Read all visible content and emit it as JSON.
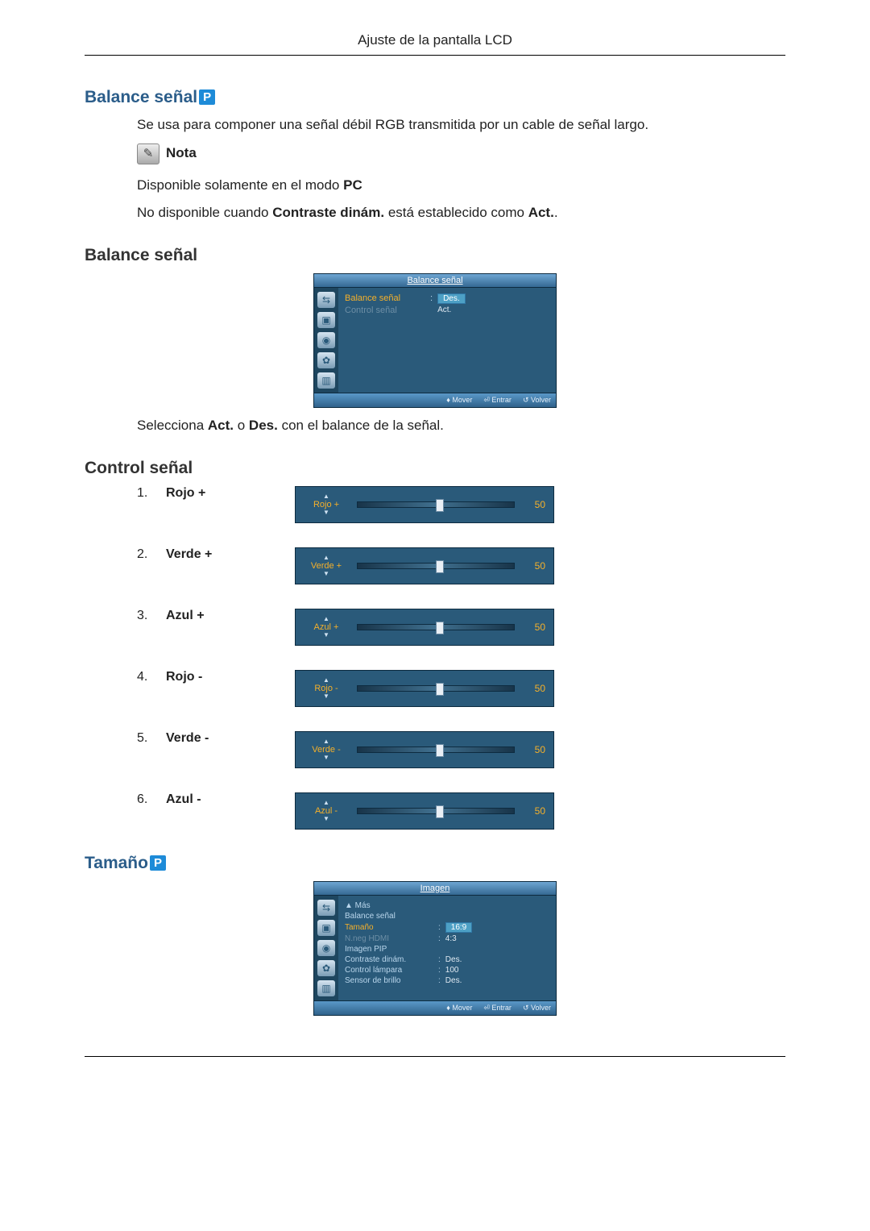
{
  "header": {
    "title": "Ajuste de la pantalla LCD"
  },
  "section1": {
    "title": "Balance señal",
    "badge": "P",
    "intro": "Se usa para componer una señal débil RGB transmitida por un cable de señal largo.",
    "note_label": "Nota",
    "notes": {
      "n1_pre": "Disponible solamente en el modo ",
      "n1_bold": "PC",
      "n2_pre": "No disponible cuando ",
      "n2_bold": "Contraste dinám.",
      "n2_mid": " está establecido como ",
      "n2_bold2": "Act.",
      "n2_end": "."
    }
  },
  "section2": {
    "title": "Balance señal",
    "osd": {
      "title": "Balance señal",
      "items": {
        "r1_label": "Balance señal",
        "r1_value": "Des.",
        "r2_label": "Control señal",
        "r2_value": "Act."
      },
      "footer": {
        "move": "Mover",
        "enter": "Entrar",
        "back": "Volver"
      }
    },
    "caption_pre": "Selecciona ",
    "caption_b1": "Act.",
    "caption_mid": " o ",
    "caption_b2": "Des.",
    "caption_end": " con el balance de la señal."
  },
  "section3": {
    "title": "Control señal",
    "sliders": [
      {
        "num": "1.",
        "label": "Rojo +",
        "slider_label": "Rojo +",
        "value": "50",
        "pos": 50
      },
      {
        "num": "2.",
        "label": "Verde +",
        "slider_label": "Verde +",
        "value": "50",
        "pos": 50
      },
      {
        "num": "3.",
        "label": "Azul +",
        "slider_label": "Azul +",
        "value": "50",
        "pos": 50
      },
      {
        "num": "4.",
        "label": "Rojo -",
        "slider_label": "Rojo -",
        "value": "50",
        "pos": 50
      },
      {
        "num": "5.",
        "label": "Verde -",
        "slider_label": "Verde -",
        "value": "50",
        "pos": 50
      },
      {
        "num": "6.",
        "label": "Azul -",
        "slider_label": "Azul -",
        "value": "50",
        "pos": 50
      }
    ]
  },
  "section4": {
    "title": "Tamaño",
    "badge": "P",
    "osd": {
      "title": "Imagen",
      "more": "▲ Más",
      "rows": [
        {
          "label": "Balance señal",
          "value": "",
          "hl": false
        },
        {
          "label": "Tamaño",
          "value": "16:9",
          "hl": true,
          "box": true
        },
        {
          "label": "N.neg HDMI",
          "value": "4:3",
          "hl": false,
          "dim": true
        },
        {
          "label": "Imagen PIP",
          "value": "",
          "hl": false
        },
        {
          "label": "Contraste dinám.",
          "value": "Des.",
          "hl": false
        },
        {
          "label": "Control lámpara",
          "value": "100",
          "hl": false
        },
        {
          "label": "Sensor de brillo",
          "value": "Des.",
          "hl": false
        }
      ],
      "footer": {
        "move": "Mover",
        "enter": "Entrar",
        "back": "Volver"
      }
    }
  }
}
